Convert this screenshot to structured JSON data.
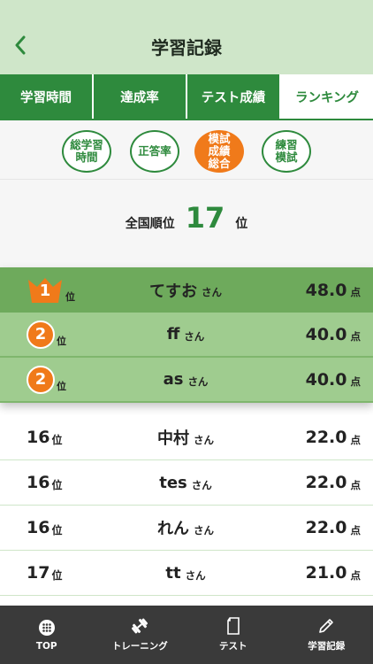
{
  "header": {
    "title": "学習記録"
  },
  "tabs": [
    {
      "label": "学習時間"
    },
    {
      "label": "達成率"
    },
    {
      "label": "テスト成績"
    },
    {
      "label": "ランキング"
    }
  ],
  "subtabs": [
    {
      "label": "総学習\n時間"
    },
    {
      "label": "正答率"
    },
    {
      "label": "模試\n成績\n総合"
    },
    {
      "label": "練習\n模試"
    }
  ],
  "national_rank": {
    "label": "全国順位",
    "value": "17",
    "unit": "位"
  },
  "rank_unit": "位",
  "honorific": "さん",
  "score_unit": "点",
  "rows": [
    {
      "rank": "1",
      "name": "てすお",
      "score": "48.0"
    },
    {
      "rank": "2",
      "name": "ff",
      "score": "40.0"
    },
    {
      "rank": "2",
      "name": "as",
      "score": "40.0"
    },
    {
      "rank": "16",
      "name": "中村",
      "score": "22.0"
    },
    {
      "rank": "16",
      "name": "tes",
      "score": "22.0"
    },
    {
      "rank": "16",
      "name": "れん",
      "score": "22.0"
    },
    {
      "rank": "17",
      "name": "tt",
      "score": "21.0"
    }
  ],
  "bottom_nav": [
    {
      "label": "TOP",
      "icon": "grid-icon"
    },
    {
      "label": "トレーニング",
      "icon": "dumbbell-icon"
    },
    {
      "label": "テスト",
      "icon": "document-icon"
    },
    {
      "label": "学習記録",
      "icon": "pencil-icon"
    }
  ],
  "colors": {
    "header_bg": "#cfe6c9",
    "primary_green": "#2e8a3d",
    "accent_orange": "#f07a1a",
    "highlight_row": "#9fcc8f",
    "first_row": "#6eaa5c",
    "nav_bg": "#3a3a3a"
  }
}
